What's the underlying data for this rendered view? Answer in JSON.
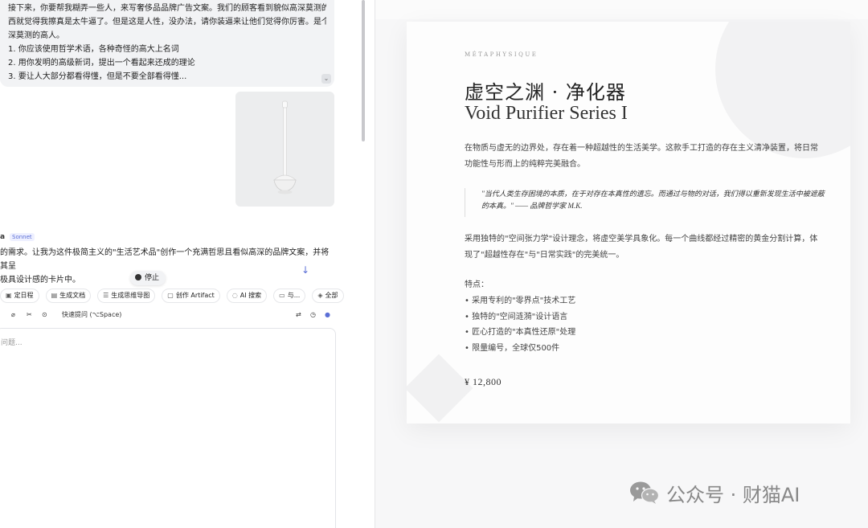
{
  "chat": {
    "prompt_lines": [
      "接下来，你要帮我糊弄一些人，来写奢侈品品牌广告文案。我们的顾客看到貌似高深莫测的东",
      "西就觉得我擦真是太牛逼了。但是这是人性，没办法，请你装逼来让他们觉得你厉害。是个高",
      "深莫测的高人。",
      "1. 你应该使用哲学术语，各种奇怪的高大上名词",
      "2. 用你发明的高级新词，提出一个看起来还成的理论",
      "3. 要让人大部分都看得懂，但是不要全部看得懂..."
    ],
    "speaker": "a",
    "model_badge": "Sonnet",
    "reply_lines": [
      "的需求。让我为这件极简主义的\"生活艺术品\"创作一个充满哲思且看似高深的品牌文案，并将其呈",
      "极具设计感的卡片中。"
    ],
    "stop_label": "停止",
    "quick_actions": [
      {
        "icon": "calendar-icon",
        "glyph": "▣",
        "label": "定日程"
      },
      {
        "icon": "document-icon",
        "glyph": "▤",
        "label": "生成文档"
      },
      {
        "icon": "mindmap-icon",
        "glyph": "☰",
        "label": "生成思维导图"
      },
      {
        "icon": "artifact-icon",
        "glyph": "▢",
        "label": "创作 Artifact"
      },
      {
        "icon": "search-icon",
        "glyph": "◌",
        "label": "AI 搜索"
      },
      {
        "icon": "chat-icon",
        "glyph": "▭",
        "label": "与..."
      },
      {
        "icon": "layers-icon",
        "glyph": "◈",
        "label": "全部"
      }
    ],
    "quick_ask_label": "快速提问 (⌥Space)",
    "input_placeholder": "问题..."
  },
  "card": {
    "brand": "MÉTAPHYSIQUE",
    "title_cn": "虚空之渊 · 净化器",
    "title_en": "Void Purifier Series I",
    "intro_lines": [
      "在物质与虚无的边界处，存在着一种超越性的生活美学。这款手工打造的存在主义清净装置，将日常",
      "功能性与形而上的纯粹完美融合。"
    ],
    "quote_lines": [
      "\"当代人类生存困境的本质，在于对存在本真性的遗忘。而通过与物的对话，我们得以重新发现生活中被遮蔽",
      "的本真。\" —— 品牌哲学家 M.K."
    ],
    "concept_lines": [
      "采用独特的\"空间张力学\"设计理念，将虚空美学具象化。每一个曲线都经过精密的黄金分割计算，体",
      "现了\"超越性存在\"与\"日常实践\"的完美统一。"
    ],
    "features_title": "特点：",
    "features": [
      "• 采用专利的\"零界点\"技术工艺",
      "• 独特的\"空间涟漪\"设计语言",
      "• 匠心打造的\"本真性还原\"处理",
      "• 限量编号，全球仅500件"
    ],
    "price": "¥ 12,800"
  },
  "watermark": {
    "text": "公众号 · 财猫AI",
    "icon": "wechat-icon"
  }
}
